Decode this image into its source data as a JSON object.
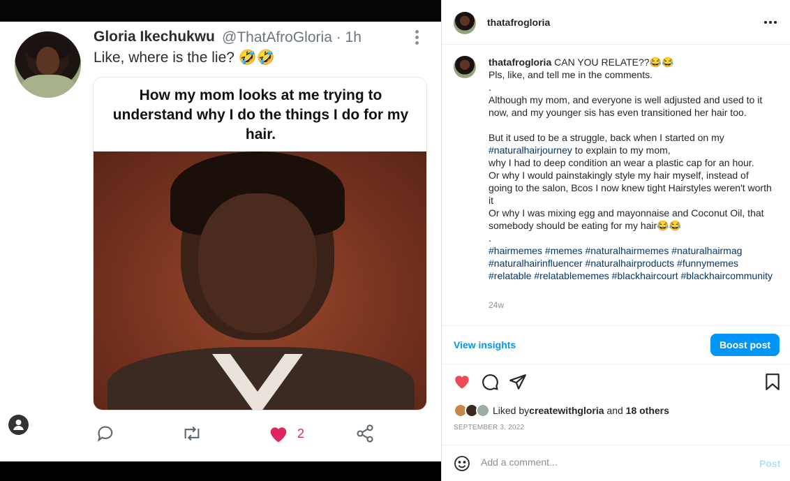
{
  "tweet": {
    "name": "Gloria Ikechukwu",
    "handle": "@ThatAfroGloria · 1h",
    "text": "Like, where is the lie? 🤣🤣",
    "meme_caption": "How my mom looks at me trying to understand why I do the things I do for my hair.",
    "like_count": "2",
    "colors": {
      "like": "#e0245e",
      "text": "#2c2c2c"
    }
  },
  "post": {
    "header_username": "thatafrogloria",
    "caption_username": "thatafrogloria",
    "caption_lines": [
      "CAN YOU RELATE??😂😂",
      "Pls, like, and tell me in the comments.",
      ".",
      "Although my mom, and everyone is well adjusted and used to it now, and my younger sis has even transitioned her hair too.",
      "",
      "But it used to be a struggle, back when I started on my"
    ],
    "tag_journey": "#naturalhairjourney",
    "after_journey": " to explain to my mom,",
    "more_lines": [
      "why I had to deep condition an wear a plastic cap for an hour.",
      "Or why I would painstakingly style my hair myself, instead of going to the salon, Bcos I now knew tight Hairstyles weren't worth it",
      "Or why I was mixing egg and mayonnaise and Coconut Oil, that somebody should be eating for my hair😂😂",
      "."
    ],
    "hashtags": "#hairmemes #memes #naturalhairmemes #naturalhairmag #naturalhairinfluencer #naturalhairproducts #funnymemes #relatable #relatablememes #blackhaircourt #blackhaircommunity",
    "age": "24w",
    "view_insights": "View insights",
    "boost": "Boost post",
    "liked_prefix": "Liked by ",
    "liked_user": "createwithgloria",
    "liked_mid": " and ",
    "liked_others": "18 others",
    "date": "SEPTEMBER 3, 2022",
    "comment_placeholder": "Add a comment...",
    "post_label": "Post",
    "colors": {
      "accent": "#0095f6",
      "link": "#00376b",
      "heart": "#ed4956"
    }
  }
}
